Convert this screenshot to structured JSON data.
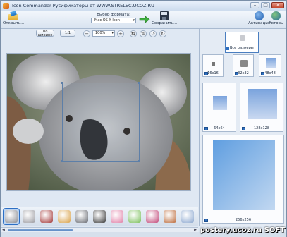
{
  "window": {
    "title": "Icon Commander   Русификаторы  от  WWW.STRELEC.UCOZ.RU"
  },
  "toolbar": {
    "open_label": "Открыть...",
    "format_label": "Выбор формата:",
    "format_value": "Mac OS X Icon",
    "save_label": "Сохранить...",
    "activate_label": "Активация",
    "authors_label": "Авторы"
  },
  "viewbar": {
    "fit_width_label": "По ширине",
    "actual_size_label": "1:1",
    "zoom_value": "100%",
    "zoom_out_glyph": "−",
    "zoom_in_glyph": "+"
  },
  "sizes": {
    "all_label": "Все размеры",
    "items": [
      {
        "label": "16x16"
      },
      {
        "label": "32x32"
      },
      {
        "label": "48x48"
      },
      {
        "label": "64x64"
      },
      {
        "label": "128x128"
      },
      {
        "label": "256x256"
      }
    ]
  },
  "thumbnails": [
    {
      "name": "koala",
      "color": "#8d8f95"
    },
    {
      "name": "koala-small",
      "color": "#9a9aa0"
    },
    {
      "name": "wine",
      "color": "#a43a3a"
    },
    {
      "name": "cake",
      "color": "#d9a24a"
    },
    {
      "name": "tv",
      "color": "#6a6d74"
    },
    {
      "name": "film",
      "color": "#3d3d3d"
    },
    {
      "name": "gift",
      "color": "#e07fa6"
    },
    {
      "name": "gift-green",
      "color": "#7bbf5b"
    },
    {
      "name": "cow",
      "color": "#c24a7a"
    },
    {
      "name": "character",
      "color": "#bb6a3a"
    },
    {
      "name": "extra",
      "color": "#8ba7cf"
    }
  ],
  "watermark": "postery.ucoz.ru SOFT",
  "colors": {
    "accent": "#2f6fbf",
    "toolbar_bg": "#dfe8f3"
  }
}
